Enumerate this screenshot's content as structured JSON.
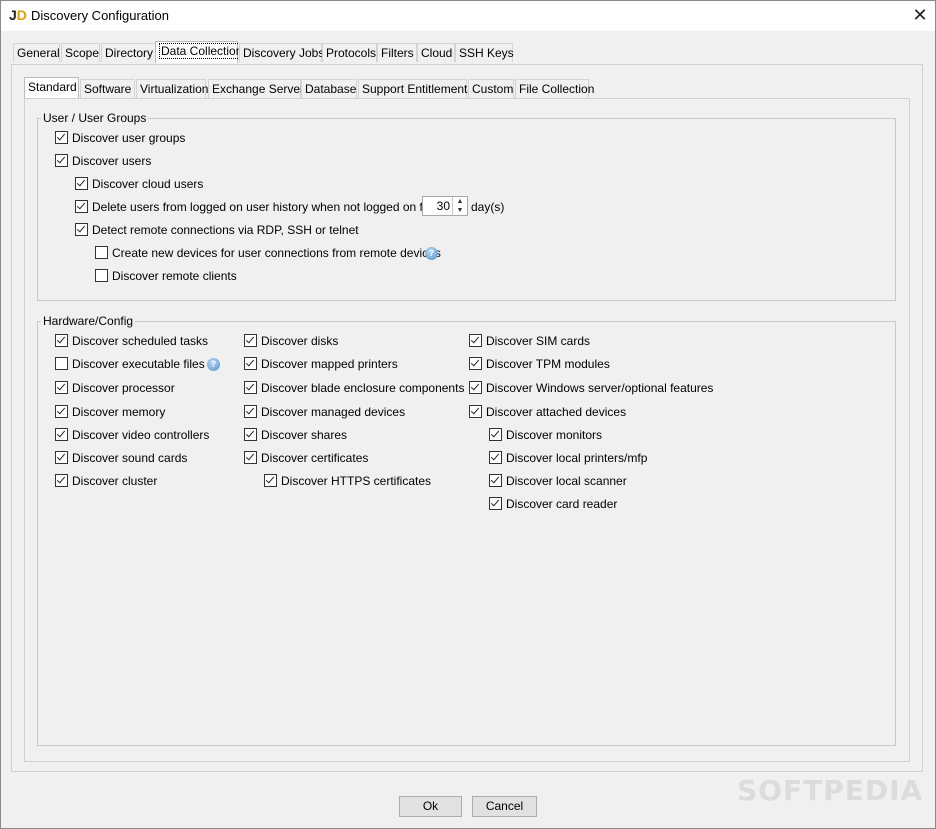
{
  "window": {
    "title": "Discovery Configuration",
    "close_glyph": "✕"
  },
  "top_tabs": [
    "General",
    "Scope",
    "Directory",
    "Data Collection",
    "Discovery Jobs",
    "Protocols",
    "Filters",
    "Cloud",
    "SSH Keys"
  ],
  "top_tabs_active": "Data Collection",
  "sub_tabs": [
    "Standard",
    "Software",
    "Virtualization",
    "Exchange Server",
    "Database",
    "Support Entitlements",
    "Custom",
    "File Collection"
  ],
  "sub_tabs_active": "Standard",
  "user_groups": {
    "legend": "User / User Groups",
    "discover_user_groups": {
      "label": "Discover user groups",
      "checked": true
    },
    "discover_users": {
      "label": "Discover users",
      "checked": true
    },
    "discover_cloud_users": {
      "label": "Discover cloud users",
      "checked": true
    },
    "delete_users": {
      "label": "Delete users from logged on user history when not logged on for",
      "checked": true
    },
    "days_value": "30",
    "days_unit": "day(s)",
    "detect_remote": {
      "label": "Detect remote connections via RDP, SSH or telnet",
      "checked": true
    },
    "create_devices": {
      "label": "Create new devices for user connections from remote devices",
      "checked": false
    },
    "discover_remote_clients": {
      "label": "Discover remote clients",
      "checked": false
    }
  },
  "hardware": {
    "legend": "Hardware/Config",
    "col1": [
      {
        "label": "Discover scheduled tasks",
        "checked": true
      },
      {
        "label": "Discover executable files",
        "checked": false
      },
      {
        "label": "Discover processor",
        "checked": true
      },
      {
        "label": "Discover memory",
        "checked": true
      },
      {
        "label": "Discover video controllers",
        "checked": true
      },
      {
        "label": "Discover sound cards",
        "checked": true
      },
      {
        "label": "Discover cluster",
        "checked": true
      }
    ],
    "col2": [
      {
        "label": "Discover disks",
        "checked": true
      },
      {
        "label": "Discover mapped printers",
        "checked": true
      },
      {
        "label": "Discover blade enclosure components",
        "checked": true
      },
      {
        "label": "Discover managed devices",
        "checked": true
      },
      {
        "label": "Discover shares",
        "checked": true
      },
      {
        "label": "Discover certificates",
        "checked": true
      },
      {
        "label": "Discover HTTPS certificates",
        "checked": true
      }
    ],
    "col3": [
      {
        "label": "Discover SIM cards",
        "checked": true
      },
      {
        "label": "Discover TPM modules",
        "checked": true
      },
      {
        "label": "Discover Windows server/optional features",
        "checked": true
      },
      {
        "label": "Discover attached devices",
        "checked": true
      },
      {
        "label": "Discover monitors",
        "checked": true
      },
      {
        "label": "Discover local printers/mfp",
        "checked": true
      },
      {
        "label": "Discover local scanner",
        "checked": true
      },
      {
        "label": "Discover card reader",
        "checked": true
      }
    ]
  },
  "buttons": {
    "ok": "Ok",
    "cancel": "Cancel"
  },
  "watermark": "SOFTPEDIA"
}
